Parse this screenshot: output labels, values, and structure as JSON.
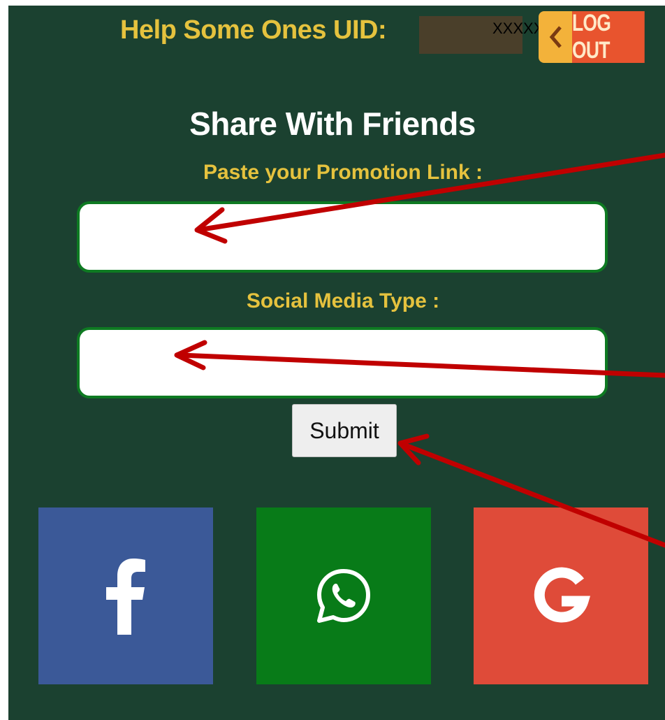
{
  "header": {
    "uid_label": "Help Some Ones UID:",
    "uid_value": "XXXXXXX",
    "logout_label": "LOG OUT",
    "logout_icon": "logout-arrow-icon"
  },
  "form": {
    "title": "Share With Friends",
    "promotion_link_label": "Paste your Promotion Link :",
    "promotion_link_value": "",
    "social_media_type_label": "Social Media Type :",
    "social_media_type_value": "",
    "submit_label": "Submit"
  },
  "share_buttons": [
    {
      "name": "facebook",
      "icon": "facebook-icon",
      "color": "#3b5998"
    },
    {
      "name": "whatsapp",
      "icon": "whatsapp-icon",
      "color": "#087b18"
    },
    {
      "name": "google",
      "icon": "google-icon",
      "color": "#df4b39"
    }
  ],
  "annotations": {
    "arrow_color": "#c00000",
    "arrow_icon": "red-arrow-annotation"
  },
  "colors": {
    "background": "#1b4130",
    "label_yellow": "#e5c23e",
    "input_border": "#0e7a22"
  }
}
